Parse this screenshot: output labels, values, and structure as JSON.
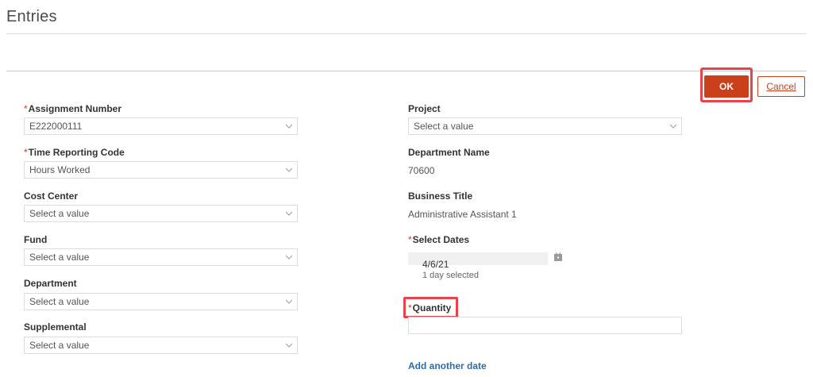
{
  "page": {
    "title": "Entries"
  },
  "actions": {
    "ok_label": "OK",
    "cancel_label": "Cancel"
  },
  "required_marker": "*",
  "left_fields": {
    "assignment_number": {
      "label": "Assignment Number",
      "required": true,
      "value": "E222000111"
    },
    "time_reporting_code": {
      "label": "Time Reporting Code",
      "required": true,
      "value": "Hours Worked"
    },
    "cost_center": {
      "label": "Cost Center",
      "required": false,
      "value": "Select a value"
    },
    "fund": {
      "label": "Fund",
      "required": false,
      "value": "Select a value"
    },
    "department": {
      "label": "Department",
      "required": false,
      "value": "Select a value"
    },
    "supplemental": {
      "label": "Supplemental",
      "required": false,
      "value": "Select a value"
    }
  },
  "right_fields": {
    "project": {
      "label": "Project",
      "value": "Select a value"
    },
    "department_name": {
      "label": "Department Name",
      "value": "70600"
    },
    "business_title": {
      "label": "Business Title",
      "value": "Administrative Assistant 1"
    },
    "select_dates": {
      "label": "Select Dates",
      "required": true,
      "value": "4/6/21",
      "summary": "1 day selected"
    },
    "quantity": {
      "label": "Quantity",
      "required": true,
      "value": ""
    },
    "add_date_link": "Add another date"
  },
  "colors": {
    "accent": "#c9401b",
    "highlight": "#e8434b",
    "link": "#2a6cb5"
  },
  "icons": {
    "dropdown": "chevron-down-icon",
    "calendar": "calendar-icon"
  }
}
